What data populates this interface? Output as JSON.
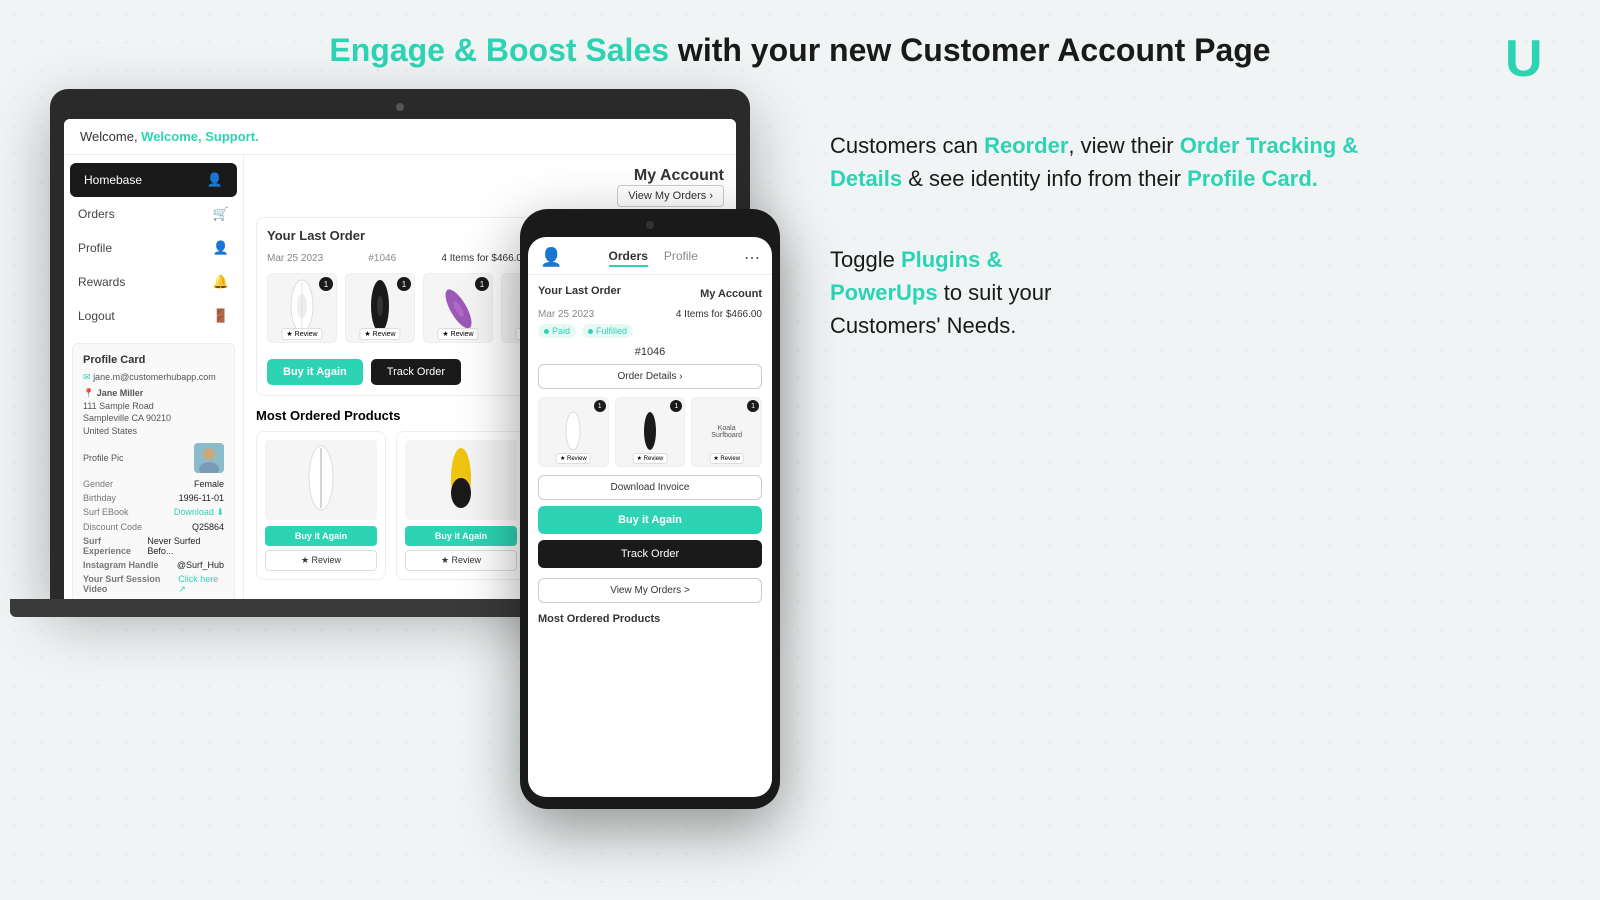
{
  "header": {
    "title_accent": "Engage & Boost Sales",
    "title_rest": " with your new Customer Account Page"
  },
  "right_panel": {
    "block1": {
      "text_plain": "Customers can ",
      "reorder": "Reorder",
      "text2": ", view their ",
      "order_tracking": "Order Tracking & Details",
      "text3": " & see identity info from their ",
      "profile_card": "Profile Card.",
      "text4": ""
    },
    "block2": {
      "text_plain": "Toggle ",
      "plugins": "Plugins & PowerUps",
      "text2": " to suit your Customers' Needs."
    }
  },
  "laptop": {
    "welcome": "Welcome, Support.",
    "sidebar": {
      "homebase": "Homebase",
      "orders": "Orders",
      "profile": "Profile",
      "rewards": "Rewards",
      "logout": "Logout"
    },
    "profile_card": {
      "title": "Profile Card",
      "email": "jane.m@customerhubapp.com",
      "name": "Jane Miller",
      "address": "111 Sample Road\nSampleville CA 90210\nUnited States",
      "fields": [
        {
          "label": "Gender",
          "value": "Female"
        },
        {
          "label": "Birthday",
          "value": "1996-11-01"
        },
        {
          "label": "Surf EBook",
          "value": "Download"
        },
        {
          "label": "Discount Code",
          "value": "Q25864"
        },
        {
          "label": "Surf Experience",
          "value": "Never Surfed Befo..."
        },
        {
          "label": "Instagram Handle",
          "value": "@Surf_Hub"
        },
        {
          "label": "Your Surf Session Video",
          "value": "Click here"
        }
      ]
    },
    "main": {
      "my_account": "My Account",
      "view_my_orders": "View My Orders",
      "last_order_title": "Your Last Order",
      "order_date": "Mar 25 2023",
      "order_id": "#1046",
      "order_items": "4 Items for $466.00",
      "paid_badge": "Paid",
      "fulfilled_badge": "Fulfilled",
      "order_details_btn": "Order Details",
      "download_invoice_btn": "Download Invoice",
      "buy_again_btn": "Buy it Again",
      "track_order_btn": "Track Order",
      "most_ordered_title": "Most Ordered Products",
      "buy_it_again": "Buy it Again",
      "review_btn": "★ Review"
    }
  },
  "phone": {
    "tabs": [
      "Orders",
      "Profile"
    ],
    "active_tab": "Orders",
    "menu_icon": "⋯",
    "last_order": "Your Last Order",
    "my_account": "My Account",
    "order_date": "Mar 25 2023",
    "order_total": "4 Items for $466.00",
    "paid": "Paid",
    "fulfilled": "Fulfilled",
    "order_id": "#1046",
    "order_details": "Order Details",
    "download_invoice": "Download Invoice",
    "buy_again": "Buy it Again",
    "track_order": "Track Order",
    "view_my_orders": "View My Orders >",
    "most_ordered": "Most Ordered Products",
    "koala_surfboard": "Koala\nSurfboard",
    "review": "★ Review"
  }
}
